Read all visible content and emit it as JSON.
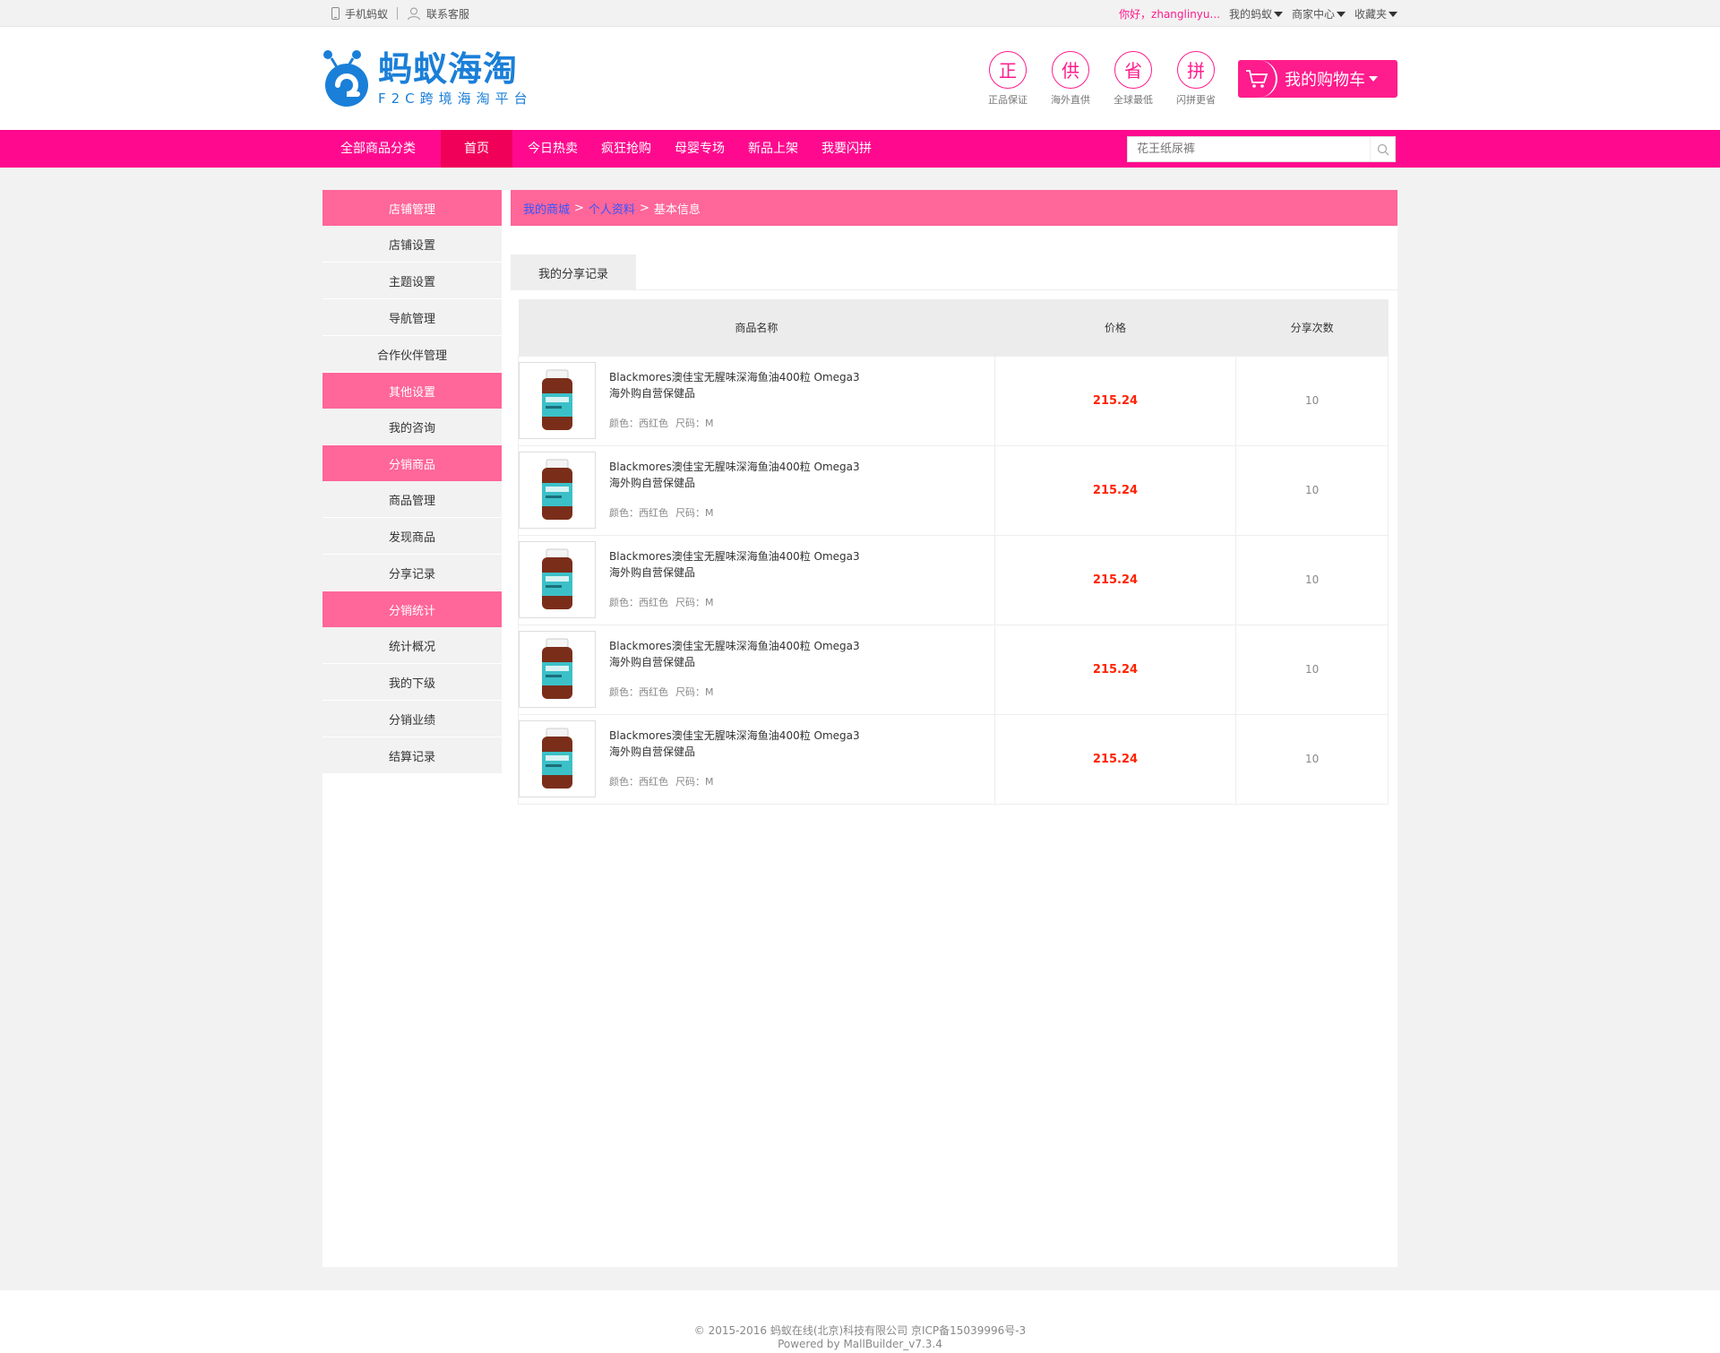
{
  "topbar": {
    "mobile_label": "手机蚂蚁",
    "service_label": "联系客服",
    "greeting": "你好，zhanglinyu...",
    "my_ant": "我的蚂蚁",
    "merchant": "商家中心",
    "favorites": "收藏夹"
  },
  "header": {
    "logo_cn": "蚂蚁海淘",
    "logo_en": "F2C跨境海淘平台",
    "badges": [
      {
        "char": "正",
        "label": "正品保证"
      },
      {
        "char": "供",
        "label": "海外直供"
      },
      {
        "char": "省",
        "label": "全球最低"
      },
      {
        "char": "拼",
        "label": "闪拼更省"
      }
    ],
    "cart_label": "我的购物车"
  },
  "nav": {
    "all": "全部商品分类",
    "items": [
      "首页",
      "今日热卖",
      "疯狂抢购",
      "母婴专场",
      "新品上架",
      "我要闪拼"
    ],
    "search_placeholder": "花王纸尿裤"
  },
  "sidebar": {
    "groups": [
      {
        "head": "店铺管理",
        "items": [
          "店铺设置",
          "主题设置",
          "导航管理",
          "合作伙伴管理"
        ]
      },
      {
        "head": "其他设置",
        "items": [
          "我的咨询"
        ]
      },
      {
        "head": "分销商品",
        "items": [
          "商品管理",
          "发现商品",
          "分享记录"
        ]
      },
      {
        "head": "分销统计",
        "items": [
          "统计概况",
          "我的下级",
          "分销业绩",
          "结算记录"
        ]
      }
    ]
  },
  "breadcrumb": {
    "mall": "我的商城",
    "sep1": ">",
    "profile": "个人资料",
    "sep2": ">",
    "current": "基本信息"
  },
  "tab": {
    "label": "我的分享记录"
  },
  "table": {
    "headers": [
      "商品名称",
      "价格",
      "分享次数"
    ],
    "rows": [
      {
        "name_line1": "Blackmores澳佳宝无腥味深海鱼油400粒 Omega3",
        "name_line2": "海外购自营保健品",
        "color": "颜色：西红色",
        "size": "尺码：M",
        "price": "215.24",
        "count": "10"
      },
      {
        "name_line1": "Blackmores澳佳宝无腥味深海鱼油400粒 Omega3",
        "name_line2": "海外购自营保健品",
        "color": "颜色：西红色",
        "size": "尺码：M",
        "price": "215.24",
        "count": "10"
      },
      {
        "name_line1": "Blackmores澳佳宝无腥味深海鱼油400粒 Omega3",
        "name_line2": "海外购自营保健品",
        "color": "颜色：西红色",
        "size": "尺码：M",
        "price": "215.24",
        "count": "10"
      },
      {
        "name_line1": "Blackmores澳佳宝无腥味深海鱼油400粒 Omega3",
        "name_line2": "海外购自营保健品",
        "color": "颜色：西红色",
        "size": "尺码：M",
        "price": "215.24",
        "count": "10"
      },
      {
        "name_line1": "Blackmores澳佳宝无腥味深海鱼油400粒 Omega3",
        "name_line2": "海外购自营保健品",
        "color": "颜色：西红色",
        "size": "尺码：M",
        "price": "215.24",
        "count": "10"
      }
    ]
  },
  "footer": {
    "line1": "© 2015-2016 蚂蚁在线(北京)科技有限公司 京ICP备15039996号-3",
    "line2": "Powered by MallBuilder_v7.3.4"
  },
  "colors": {
    "brand_pink": "#ff0a8e",
    "sidebar_head": "#ff6699",
    "logo_blue": "#1a7fd8",
    "price_red": "#ff2200"
  }
}
